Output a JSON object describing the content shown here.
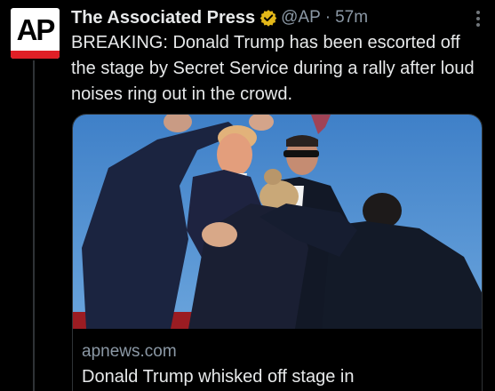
{
  "tweet": {
    "author": {
      "avatar_text": "AP",
      "display_name": "The Associated Press",
      "handle": "@AP",
      "separator": "·",
      "time": "57m"
    },
    "text": "BREAKING: Donald Trump has been escorted off the stage by Secret Service during a rally after loud noises ring out in the crowd.",
    "link_card": {
      "domain": "apnews.com",
      "title": "Donald Trump whisked off stage in"
    }
  },
  "colors": {
    "background": "#000000",
    "text_primary": "#e7e9ea",
    "text_secondary": "#8b98a5",
    "verified_gold": "#e2b719",
    "ap_red": "#e01f26",
    "sky_blue": "#4f8fd2"
  },
  "icons": {
    "verified": "verified-badge-icon",
    "more": "more-options-icon"
  }
}
